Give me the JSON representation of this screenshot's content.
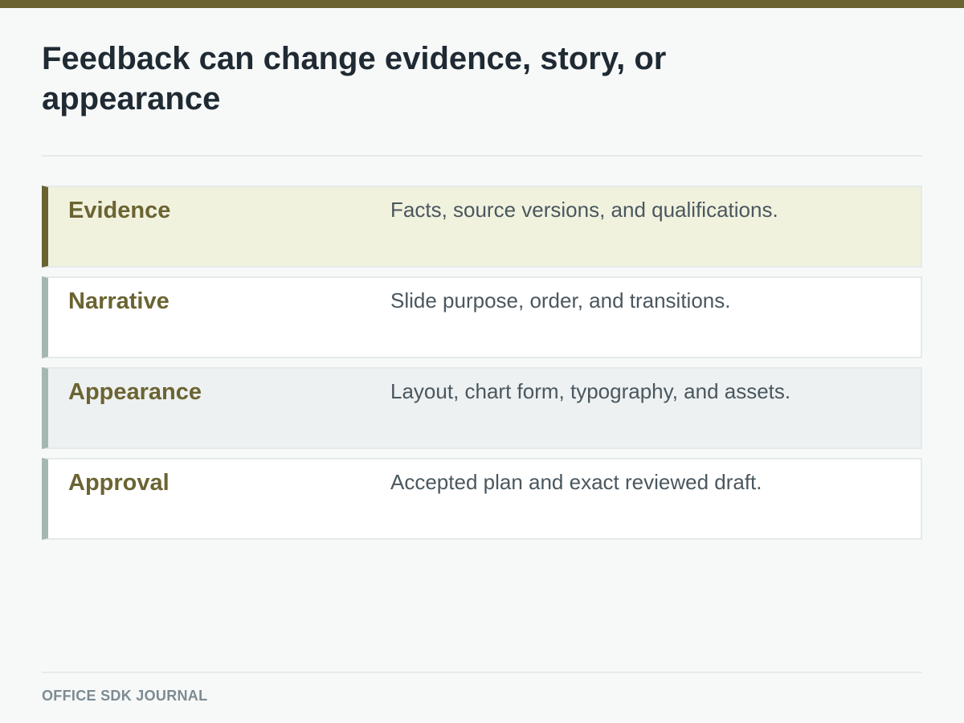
{
  "title": "Feedback can change evidence, story, or appearance",
  "rows": [
    {
      "label": "Evidence",
      "description": "Facts, source versions, and qualifications.",
      "style": "highlight"
    },
    {
      "label": "Narrative",
      "description": "Slide purpose, order, and transitions.",
      "style": "plain"
    },
    {
      "label": "Appearance",
      "description": "Layout, chart form, typography, and assets.",
      "style": "muted"
    },
    {
      "label": "Approval",
      "description": "Accepted plan and exact reviewed draft.",
      "style": "plain"
    }
  ],
  "footer": "OFFICE SDK JOURNAL",
  "colors": {
    "accent": "#6b6432",
    "highlight_background": "#f1f2de",
    "row_border": "#a3b8b2",
    "title_text": "#1f2a33",
    "body_text": "#4a575f"
  }
}
